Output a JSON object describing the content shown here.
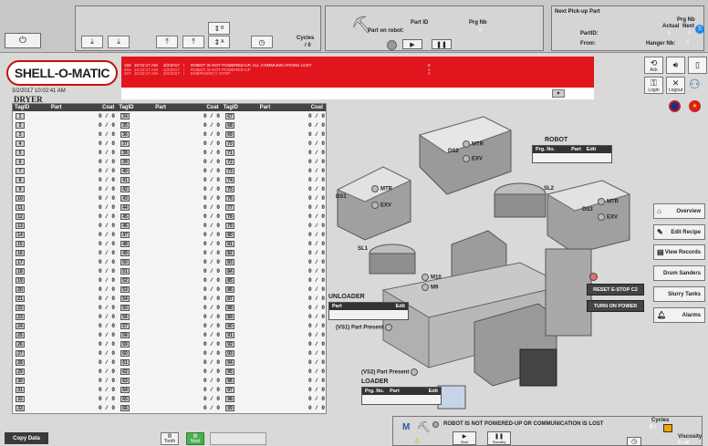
{
  "toolbar": {
    "power_icon": "power-icon",
    "cycles_label": "Cycles",
    "cycles_value": "/ 0",
    "bin_a": "A",
    "bin_b": "B"
  },
  "robot_status": {
    "part_id_label": "Part ID",
    "prg_nb_label": "Prg Nb",
    "part_on_robot_label": "Part on robot:",
    "prg_value": "0"
  },
  "pickup": {
    "title": "Next Pick-up Part",
    "prg_nb_label": "Prg Nb",
    "actual_label": "Actual",
    "next_label": "Next",
    "partid_label": "PartID:",
    "from_label": "From:",
    "hanger_label": "Hanger Nb:",
    "actual_value": "0",
    "next_value": "0",
    "hanger_value": "0"
  },
  "header": {
    "logo": "SHELL-O-MATIC",
    "datetime": "3/2/2017 10:02:41 AM"
  },
  "alarms": [
    {
      "id": "196",
      "time": "10:02:17 AM",
      "date": "3/2/2017",
      "flag": "!",
      "message": "ROBOT IS NOT POWERED-UP, ALL COMMUNICATIONS LOST",
      "count": "0"
    },
    {
      "id": "204",
      "time": "10:02:17 AM",
      "date": "3/2/2017",
      "flag": "!",
      "message": "ROBOT IS NOT POWERED-UP",
      "count": "0"
    },
    {
      "id": "237",
      "time": "10:02:17 AM",
      "date": "3/2/2017",
      "flag": "!",
      "message": "EMERGENCY STOP",
      "count": "0"
    }
  ],
  "side_buttons": {
    "ack_label": "Ack",
    "login_label": "Login",
    "logout_label": "Logout"
  },
  "dryer": {
    "title": "DRYER",
    "headers": [
      "TagID",
      "Part",
      "Coat"
    ],
    "coat_value": "0 / 0"
  },
  "scene": {
    "robot_title": "ROBOT",
    "robot_cols": [
      "Prg. No.",
      "Part",
      "Edit"
    ],
    "ds1": "DS1",
    "ds2": "DS2",
    "ds3": "DS3",
    "mtr": "MTR",
    "exv": "EXV",
    "sl1": "SL1",
    "sl2": "SL2",
    "m10": "M10",
    "m9": "M9",
    "unloader_title": "UNLOADER",
    "unloader_cols": [
      "Part",
      "Edit"
    ],
    "vs1": "(VS1) Part Present",
    "vs2": "(VS2) Part Present",
    "loader_title": "LOADER",
    "loader_cols": [
      "Prg. No.",
      "Part",
      "Edit"
    ],
    "reset_label": "RESET E-STOP C2",
    "turn_on_label": "TURN ON POWER"
  },
  "nav": {
    "overview": "Overview",
    "edit_recipe": "Edit Recipe",
    "view_records": "View Records",
    "drum_sanders": "Drum Sanders",
    "slurry_tanks": "Slurry Tanks",
    "alarms": "Alarms"
  },
  "bottom": {
    "copy_label": "Copy Data",
    "status_message": "ROBOT IS NOT POWERED-UP OR COMMUNICATION IS LOST",
    "cycles_label": "Cycles",
    "cycles_value": "0 /",
    "viscosity_label": "Viscosity",
    "viscosity_value": "0 / 40",
    "start_label": "Start",
    "standby_label": "Standby",
    "m_label": "M",
    "tooth_label": "Tooth",
    "next_label": "Next"
  }
}
